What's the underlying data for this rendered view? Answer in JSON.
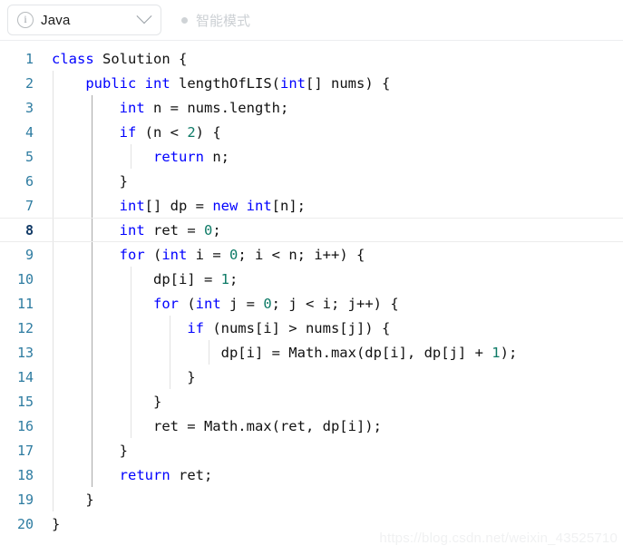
{
  "toolbar": {
    "language_label": "Java",
    "info_icon": "info-icon",
    "chevron_icon": "chevron-down-icon",
    "smart_mode_label": "智能模式",
    "smart_mode_dot": "status-dot"
  },
  "editor": {
    "language": "java",
    "active_line": 8,
    "colors": {
      "keyword": "#0000ff",
      "number": "#0d7a66",
      "text": "#111111",
      "line_number": "#2e7ca1",
      "line_number_active": "#123a66",
      "indent_guide": "#e2e2e2",
      "indent_guide_active": "#a8a8a8",
      "background": "#ffffff"
    },
    "lines": [
      {
        "n": "1",
        "text": "class Solution {"
      },
      {
        "n": "2",
        "text": "    public int lengthOfLIS(int[] nums) {"
      },
      {
        "n": "3",
        "text": "        int n = nums.length;"
      },
      {
        "n": "4",
        "text": "        if (n < 2) {"
      },
      {
        "n": "5",
        "text": "            return n;"
      },
      {
        "n": "6",
        "text": "        }"
      },
      {
        "n": "7",
        "text": "        int[] dp = new int[n];"
      },
      {
        "n": "8",
        "text": "        int ret = 0;"
      },
      {
        "n": "9",
        "text": "        for (int i = 0; i < n; i++) {"
      },
      {
        "n": "10",
        "text": "            dp[i] = 1;"
      },
      {
        "n": "11",
        "text": "            for (int j = 0; j < i; j++) {"
      },
      {
        "n": "12",
        "text": "                if (nums[i] > nums[j]) {"
      },
      {
        "n": "13",
        "text": "                    dp[i] = Math.max(dp[i], dp[j] + 1);"
      },
      {
        "n": "14",
        "text": "                }"
      },
      {
        "n": "15",
        "text": "            }"
      },
      {
        "n": "16",
        "text": "            ret = Math.max(ret, dp[i]);"
      },
      {
        "n": "17",
        "text": "        }"
      },
      {
        "n": "18",
        "text": "        return ret;"
      },
      {
        "n": "19",
        "text": "    }"
      },
      {
        "n": "20",
        "text": "}"
      }
    ]
  },
  "watermark": {
    "text": "https://blog.csdn.net/weixin_43525710"
  }
}
